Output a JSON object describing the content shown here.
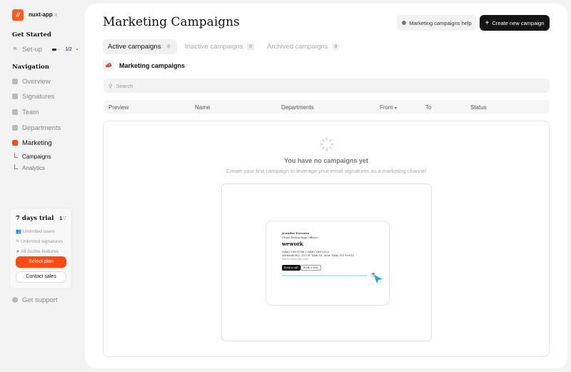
{
  "sidebar": {
    "app_name": "nuxt-app",
    "get_started": "Get Started",
    "setup": {
      "label": "Set-up",
      "progress": "1/2",
      "fraction": 0.5
    },
    "navigation": "Navigation",
    "items": [
      {
        "label": "Overview"
      },
      {
        "label": "Signatures"
      },
      {
        "label": "Team"
      },
      {
        "label": "Departments"
      },
      {
        "label": "Marketing"
      }
    ],
    "subitems": [
      {
        "label": "Campaigns"
      },
      {
        "label": "Analytics"
      }
    ],
    "trial": {
      "title": "7 days trial",
      "day": "1",
      "total": "/7",
      "features": [
        "Unlimited users",
        "Unlimited signatures",
        "All Scribe features"
      ],
      "select_plan": "Select plan",
      "contact_sales": "Contact sales"
    },
    "support": "Get support"
  },
  "header": {
    "title": "Marketing Campaigns",
    "help": "Marketing campaigns help",
    "create": "Create new campaign"
  },
  "tabs": [
    {
      "label": "Active campaigns",
      "count": "0"
    },
    {
      "label": "Inactive campaigns",
      "count": "0"
    },
    {
      "label": "Archived campaigns",
      "count": "0"
    }
  ],
  "section": {
    "title": "Marketing campaigns"
  },
  "search": {
    "placeholder": "Search"
  },
  "table": {
    "columns": [
      "Preview",
      "Name",
      "Departments",
      "From",
      "To",
      "Status"
    ]
  },
  "empty": {
    "title": "You have no campaigns yet",
    "subtitle": "Create your first campaign to leverage your email signatures as a marketing channel"
  },
  "signature": {
    "name": "Jennifer Perrotta",
    "role": "Chief Technology Officer",
    "company": "wework",
    "phones": "(646) 558-9786 | (646) 389-2922",
    "address": "WeWork HQ, 115 W 18th St. New York, NY 10011",
    "website": "www.wework.com",
    "btn1": "Book a call",
    "btn2": "Book a visit"
  },
  "colors": {
    "accent": "#ff4a12",
    "dark": "#111111",
    "banner_line": "#b8ecf8",
    "cursor": "#1aa7e6"
  }
}
